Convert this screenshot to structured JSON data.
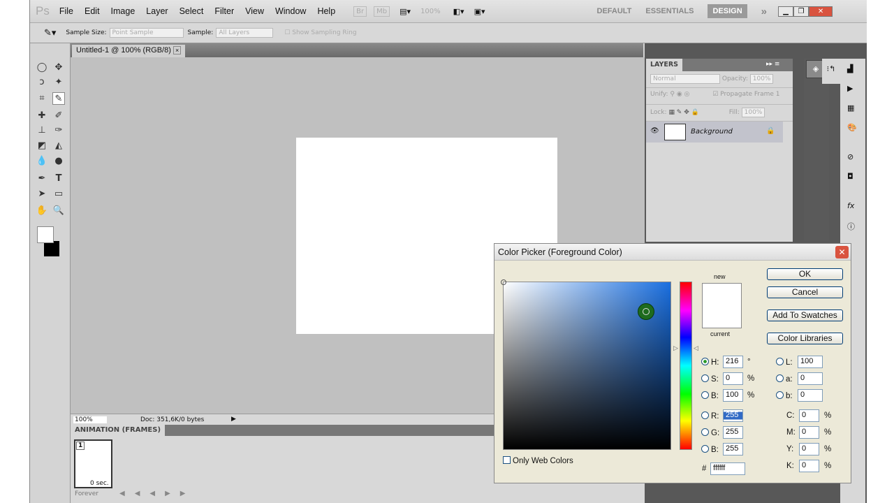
{
  "menubar": {
    "logo": "Ps",
    "items": [
      "File",
      "Edit",
      "Image",
      "Layer",
      "Select",
      "Filter",
      "View",
      "Window",
      "Help"
    ],
    "bridge": "Br",
    "minibridge": "Mb",
    "zoom": "100%",
    "workspaces": [
      "DEFAULT",
      "ESSENTIALS",
      "DESIGN"
    ],
    "active_workspace": "DESIGN",
    "more": "»"
  },
  "options": {
    "sample_size_label": "Sample Size:",
    "sample_size_value": "Point Sample",
    "sample_label": "Sample:",
    "sample_value": "All Layers",
    "sampling_ring_label": "Show Sampling Ring"
  },
  "document_tab": {
    "title": "Untitled-1 @ 100% (RGB/8)",
    "close": "×"
  },
  "status": {
    "zoom": "100%",
    "doc": "Doc: 351,6K/0 bytes"
  },
  "animation": {
    "title": "ANIMATION (FRAMES)",
    "frame_number": "1",
    "frame_delay": "0 sec.",
    "loop": "Forever"
  },
  "layers": {
    "title": "LAYERS",
    "blend_mode": "Normal",
    "opacity_label": "Opacity:",
    "opacity": "100%",
    "unify_label": "Unify:",
    "propagate_label": "Propagate Frame 1",
    "lock_label": "Lock:",
    "fill_label": "Fill:",
    "fill": "100%",
    "layer_name": "Background"
  },
  "color_picker": {
    "title": "Color Picker (Foreground Color)",
    "new_label": "new",
    "current_label": "current",
    "ok": "OK",
    "cancel": "Cancel",
    "add_swatches": "Add To Swatches",
    "color_libraries": "Color Libraries",
    "only_web": "Only Web Colors",
    "H": "216",
    "S": "0",
    "B": "100",
    "R": "255",
    "G": "255",
    "Bv": "255",
    "L": "100",
    "a": "0",
    "b": "0",
    "C": "0",
    "M": "0",
    "Y": "0",
    "K": "0",
    "hex": "ffffff",
    "labels": {
      "H": "H:",
      "S": "S:",
      "B": "B:",
      "R": "R:",
      "G": "G:",
      "Bv": "B:",
      "L": "L:",
      "a": "a:",
      "b": "b:",
      "C": "C:",
      "M": "M:",
      "Y": "Y:",
      "K": "K:",
      "hash": "#"
    },
    "units": {
      "deg": "°",
      "pct": "%"
    },
    "hue_color": "#1a6fe0"
  }
}
